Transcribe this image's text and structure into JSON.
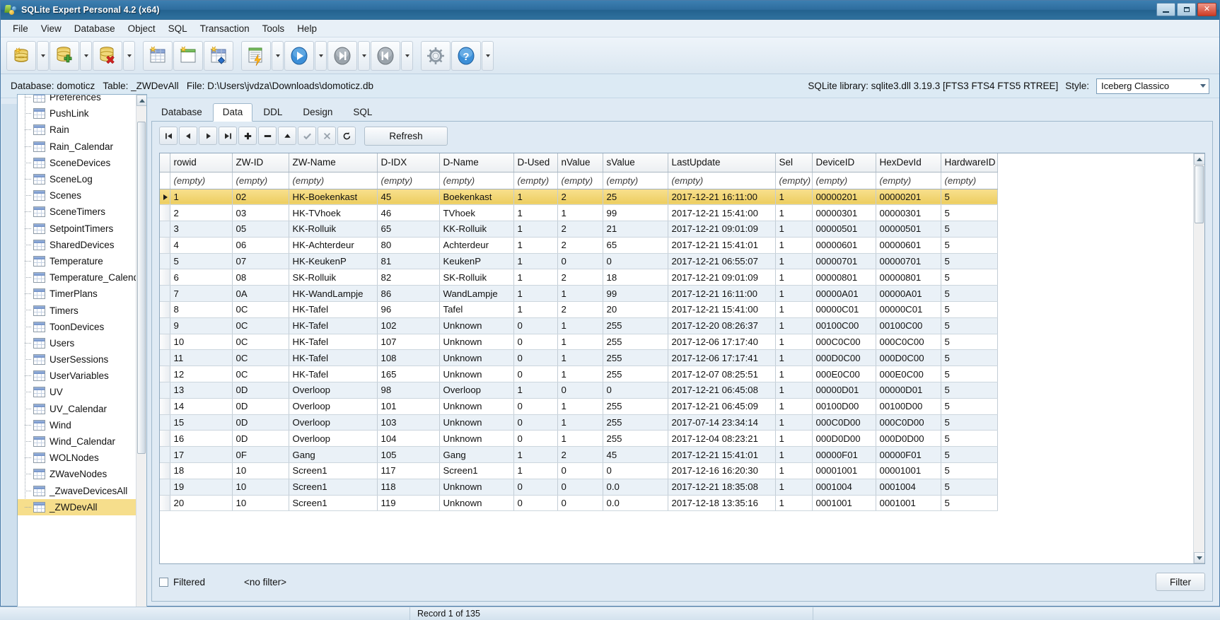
{
  "window": {
    "title": "SQLite Expert Personal 4.2 (x64)",
    "app_icon": "sqlite-expert-icon",
    "minimize": "minimize",
    "maximize": "maximize",
    "close": "close"
  },
  "menubar": {
    "items": [
      "File",
      "View",
      "Database",
      "Object",
      "SQL",
      "Transaction",
      "Tools",
      "Help"
    ]
  },
  "toolbar": {
    "buttons": [
      {
        "name": "new-database-icon",
        "label": ""
      },
      {
        "name": "attach-database-icon",
        "label": ""
      },
      {
        "name": "detach-database-icon",
        "label": ""
      },
      {
        "name": "new-table-icon",
        "label": ""
      },
      {
        "name": "new-view-icon",
        "label": ""
      },
      {
        "name": "new-index-icon",
        "label": ""
      },
      {
        "name": "execute-sql-icon",
        "label": ""
      },
      {
        "name": "run-icon",
        "label": ""
      },
      {
        "name": "step-forward-icon",
        "label": ""
      },
      {
        "name": "step-back-icon",
        "label": ""
      },
      {
        "name": "options-gear-icon",
        "label": ""
      },
      {
        "name": "help-icon",
        "label": ""
      }
    ]
  },
  "infobar": {
    "database_label": "Database: domoticz",
    "table_label": "Table: _ZWDevAll",
    "file_label": "File: D:\\Users\\jvdza\\Downloads\\domoticz.db",
    "left_text": "Database: domoticz   Table: _ZWDevAll   File: D:\\Users\\jvdza\\Downloads\\domoticz.db",
    "library_text": "SQLite library: sqlite3.dll 3.19.3 [FTS3 FTS4 FTS5 RTREE]",
    "style_label": "Style:",
    "style_value": "Iceberg Classico"
  },
  "sidebar": {
    "items": [
      {
        "label": "Preferences",
        "selected": false
      },
      {
        "label": "PushLink",
        "selected": false
      },
      {
        "label": "Rain",
        "selected": false
      },
      {
        "label": "Rain_Calendar",
        "selected": false
      },
      {
        "label": "SceneDevices",
        "selected": false
      },
      {
        "label": "SceneLog",
        "selected": false
      },
      {
        "label": "Scenes",
        "selected": false
      },
      {
        "label": "SceneTimers",
        "selected": false
      },
      {
        "label": "SetpointTimers",
        "selected": false
      },
      {
        "label": "SharedDevices",
        "selected": false
      },
      {
        "label": "Temperature",
        "selected": false
      },
      {
        "label": "Temperature_Calendar",
        "selected": false
      },
      {
        "label": "TimerPlans",
        "selected": false
      },
      {
        "label": "Timers",
        "selected": false
      },
      {
        "label": "ToonDevices",
        "selected": false
      },
      {
        "label": "Users",
        "selected": false
      },
      {
        "label": "UserSessions",
        "selected": false
      },
      {
        "label": "UserVariables",
        "selected": false
      },
      {
        "label": "UV",
        "selected": false
      },
      {
        "label": "UV_Calendar",
        "selected": false
      },
      {
        "label": "Wind",
        "selected": false
      },
      {
        "label": "Wind_Calendar",
        "selected": false
      },
      {
        "label": "WOLNodes",
        "selected": false
      },
      {
        "label": "ZWaveNodes",
        "selected": false
      },
      {
        "label": "_ZwaveDevicesAll",
        "selected": false
      },
      {
        "label": "_ZWDevAll",
        "selected": true
      }
    ]
  },
  "tabs": [
    {
      "label": "Database",
      "active": false
    },
    {
      "label": "Data",
      "active": true
    },
    {
      "label": "DDL",
      "active": false
    },
    {
      "label": "Design",
      "active": false
    },
    {
      "label": "SQL",
      "active": false
    }
  ],
  "grid_toolbar": {
    "buttons": [
      {
        "name": "first-record-button",
        "glyph": "⧏|"
      },
      {
        "name": "prior-record-button",
        "glyph": "◂"
      },
      {
        "name": "next-record-button",
        "glyph": "▸"
      },
      {
        "name": "last-record-button",
        "glyph": "|⧐"
      },
      {
        "name": "insert-record-button",
        "glyph": "➕"
      },
      {
        "name": "delete-record-button",
        "glyph": "➖"
      },
      {
        "name": "edit-record-button",
        "glyph": "▲"
      },
      {
        "name": "post-edit-button",
        "glyph": "✔"
      },
      {
        "name": "cancel-edit-button",
        "glyph": "✕"
      },
      {
        "name": "refresh-record-button",
        "glyph": "↻"
      }
    ],
    "refresh_label": "Refresh"
  },
  "grid": {
    "columns": [
      "rowid",
      "ZW-ID",
      "ZW-Name",
      "D-IDX",
      "D-Name",
      "D-Used",
      "nValue",
      "sValue",
      "LastUpdate",
      "Sel",
      "DeviceID",
      "HexDevId",
      "HardwareID"
    ],
    "filter_placeholder": "(empty)",
    "filter_row": [
      "(empty)",
      "(empty)",
      "(empty)",
      "(empty)",
      "(empty)",
      "(empty)",
      "(empty)",
      "(empty)",
      "(empty)",
      "(empty)",
      "(empty)",
      "(empty)",
      "(empty)"
    ],
    "rows": [
      {
        "selected": true,
        "cells": [
          "1",
          "02",
          "HK-Boekenkast",
          "45",
          "Boekenkast",
          "1",
          "2",
          "25",
          "2017-12-21 16:11:00",
          "1",
          "00000201",
          "00000201",
          "5"
        ]
      },
      {
        "selected": false,
        "cells": [
          "2",
          "03",
          "HK-TVhoek",
          "46",
          "TVhoek",
          "1",
          "1",
          "99",
          "2017-12-21 15:41:00",
          "1",
          "00000301",
          "00000301",
          "5"
        ]
      },
      {
        "selected": false,
        "cells": [
          "3",
          "05",
          "KK-Rolluik",
          "65",
          "KK-Rolluik",
          "1",
          "2",
          "21",
          "2017-12-21 09:01:09",
          "1",
          "00000501",
          "00000501",
          "5"
        ]
      },
      {
        "selected": false,
        "cells": [
          "4",
          "06",
          "HK-Achterdeur",
          "80",
          "Achterdeur",
          "1",
          "2",
          "65",
          "2017-12-21 15:41:01",
          "1",
          "00000601",
          "00000601",
          "5"
        ]
      },
      {
        "selected": false,
        "cells": [
          "5",
          "07",
          "HK-KeukenP",
          "81",
          "KeukenP",
          "1",
          "0",
          "0",
          "2017-12-21 06:55:07",
          "1",
          "00000701",
          "00000701",
          "5"
        ]
      },
      {
        "selected": false,
        "cells": [
          "6",
          "08",
          "SK-Rolluik",
          "82",
          "SK-Rolluik",
          "1",
          "2",
          "18",
          "2017-12-21 09:01:09",
          "1",
          "00000801",
          "00000801",
          "5"
        ]
      },
      {
        "selected": false,
        "cells": [
          "7",
          "0A",
          "HK-WandLampje",
          "86",
          "WandLampje",
          "1",
          "1",
          "99",
          "2017-12-21 16:11:00",
          "1",
          "00000A01",
          "00000A01",
          "5"
        ]
      },
      {
        "selected": false,
        "cells": [
          "8",
          "0C",
          "HK-Tafel",
          "96",
          "Tafel",
          "1",
          "2",
          "20",
          "2017-12-21 15:41:00",
          "1",
          "00000C01",
          "00000C01",
          "5"
        ]
      },
      {
        "selected": false,
        "cells": [
          "9",
          "0C",
          "HK-Tafel",
          "102",
          "Unknown",
          "0",
          "1",
          "255",
          "2017-12-20 08:26:37",
          "1",
          "00100C00",
          "00100C00",
          "5"
        ]
      },
      {
        "selected": false,
        "cells": [
          "10",
          "0C",
          "HK-Tafel",
          "107",
          "Unknown",
          "0",
          "1",
          "255",
          "2017-12-06 17:17:40",
          "1",
          "000C0C00",
          "000C0C00",
          "5"
        ]
      },
      {
        "selected": false,
        "cells": [
          "11",
          "0C",
          "HK-Tafel",
          "108",
          "Unknown",
          "0",
          "1",
          "255",
          "2017-12-06 17:17:41",
          "1",
          "000D0C00",
          "000D0C00",
          "5"
        ]
      },
      {
        "selected": false,
        "cells": [
          "12",
          "0C",
          "HK-Tafel",
          "165",
          "Unknown",
          "0",
          "1",
          "255",
          "2017-12-07 08:25:51",
          "1",
          "000E0C00",
          "000E0C00",
          "5"
        ]
      },
      {
        "selected": false,
        "cells": [
          "13",
          "0D",
          "Overloop",
          "98",
          "Overloop",
          "1",
          "0",
          "0",
          "2017-12-21 06:45:08",
          "1",
          "00000D01",
          "00000D01",
          "5"
        ]
      },
      {
        "selected": false,
        "cells": [
          "14",
          "0D",
          "Overloop",
          "101",
          "Unknown",
          "0",
          "1",
          "255",
          "2017-12-21 06:45:09",
          "1",
          "00100D00",
          "00100D00",
          "5"
        ]
      },
      {
        "selected": false,
        "cells": [
          "15",
          "0D",
          "Overloop",
          "103",
          "Unknown",
          "0",
          "1",
          "255",
          "2017-07-14 23:34:14",
          "1",
          "000C0D00",
          "000C0D00",
          "5"
        ]
      },
      {
        "selected": false,
        "cells": [
          "16",
          "0D",
          "Overloop",
          "104",
          "Unknown",
          "0",
          "1",
          "255",
          "2017-12-04 08:23:21",
          "1",
          "000D0D00",
          "000D0D00",
          "5"
        ]
      },
      {
        "selected": false,
        "cells": [
          "17",
          "0F",
          "Gang",
          "105",
          "Gang",
          "1",
          "2",
          "45",
          "2017-12-21 15:41:01",
          "1",
          "00000F01",
          "00000F01",
          "5"
        ]
      },
      {
        "selected": false,
        "cells": [
          "18",
          "10",
          "Screen1",
          "117",
          "Screen1",
          "1",
          "0",
          "0",
          "2017-12-16 16:20:30",
          "1",
          "00001001",
          "00001001",
          "5"
        ]
      },
      {
        "selected": false,
        "cells": [
          "19",
          "10",
          "Screen1",
          "118",
          "Unknown",
          "0",
          "0",
          "0.0",
          "2017-12-21 18:35:08",
          "1",
          "0001004",
          "0001004",
          "5"
        ]
      },
      {
        "selected": false,
        "cells": [
          "20",
          "10",
          "Screen1",
          "119",
          "Unknown",
          "0",
          "0",
          "0.0",
          "2017-12-18 13:35:16",
          "1",
          "0001001",
          "0001001",
          "5"
        ]
      }
    ]
  },
  "bottombar": {
    "filtered_label": "Filtered",
    "no_filter_text": "<no filter>",
    "filter_button": "Filter"
  },
  "statusbar": {
    "segment1": "",
    "record_text": "Record 1 of 135",
    "segment3": ""
  },
  "colors": {
    "title_blue": "#2e6d9e",
    "selection_yellow": "#f6de8c",
    "row_alt": "#eaf1f7",
    "panel_bg": "#dfeaf4"
  }
}
